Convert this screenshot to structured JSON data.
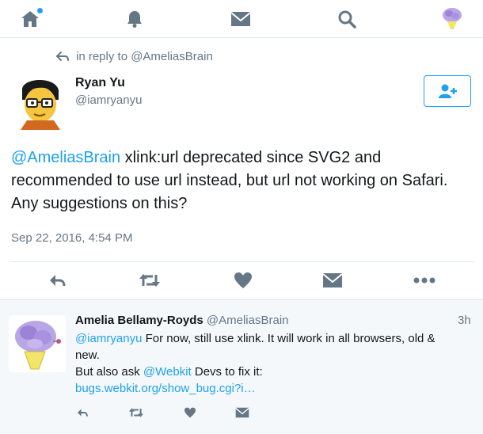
{
  "nav": {
    "items": [
      {
        "name": "home-icon"
      },
      {
        "name": "notifications-icon"
      },
      {
        "name": "messages-icon"
      },
      {
        "name": "search-icon"
      },
      {
        "name": "profile-avatar"
      }
    ],
    "accent": "#1da1f2",
    "icon_color": "#657786"
  },
  "tweet": {
    "reply_context": "in reply to @AmeliasBrain",
    "author_name": "Ryan Yu",
    "author_handle": "@iamryanyu",
    "mention": "@AmeliasBrain",
    "text_line1": " xlink:url deprecated since SVG2 and",
    "text_line2": "recommended to use url instead, but url not working on Safari.",
    "text_line3": "Any suggestions on this?",
    "timestamp": "Sep 22, 2016, 4:54 PM",
    "follow_icon": "add-user-icon"
  },
  "actions": [
    "reply-icon",
    "retweet-icon",
    "like-icon",
    "direct-message-icon",
    "more-icon"
  ],
  "reply": {
    "author_name": "Amelia Bellamy-Royds",
    "author_handle": "@AmeliasBrain",
    "time": "3h",
    "mention": "@iamryanyu",
    "text_part1": " For now, still use xlink. It will work in all browsers, old &",
    "text_part2": "new.",
    "text_part3": "But also ask ",
    "mention2": "@Webkit",
    "text_part4": " Devs to fix it:",
    "link": "bugs.webkit.org/show_bug.cgi?i…"
  },
  "colors": {
    "accent": "#1da1f2",
    "muted": "#657786",
    "text": "#14171a",
    "reply_bg": "#f5f8fa",
    "border": "#e1e8ed"
  }
}
